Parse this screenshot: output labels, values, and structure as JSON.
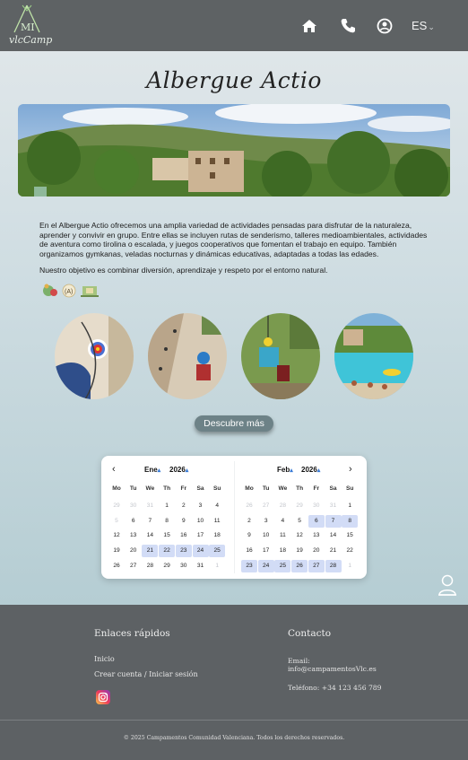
{
  "header": {
    "logo_text": "vlcCamp",
    "logo_letters": "MI",
    "language": "ES",
    "icons": [
      "home-icon",
      "phone-icon",
      "account-icon"
    ]
  },
  "main": {
    "title": "Albergue Actio",
    "paragraph1": "En el Albergue Actio ofrecemos una amplia variedad de actividades pensadas para disfrutar de la naturaleza, aprender y convivir en grupo. Entre ellas se incluyen rutas de senderismo, talleres medioambientales, actividades de aventura como tirolina o escalada, y juegos cooperativos que fomentan el trabajo en equipo. También organizamos gymkanas, veladas nocturnas y dinámicas educativas, adaptadas a todas las edades.",
    "paragraph2": "Nuestro objetivo es combinar diversión, aprendizaje y respeto por el entorno natural.",
    "badge_letter": "(A)",
    "cta": "Descubre más"
  },
  "calendar": {
    "left": {
      "month": "Ene",
      "year": "2026",
      "weekdays": [
        "Mo",
        "Tu",
        "We",
        "Th",
        "Fr",
        "Sa",
        "Su"
      ],
      "weeks": [
        [
          "29",
          "30",
          "31",
          "1",
          "2",
          "3",
          "4"
        ],
        [
          "5",
          "6",
          "7",
          "8",
          "9",
          "10",
          "11"
        ],
        [
          "12",
          "13",
          "14",
          "15",
          "16",
          "17",
          "18"
        ],
        [
          "19",
          "20",
          "21",
          "22",
          "23",
          "24",
          "25"
        ],
        [
          "26",
          "27",
          "28",
          "29",
          "30",
          "31",
          "1"
        ]
      ],
      "muted": [
        [
          0,
          0
        ],
        [
          0,
          1
        ],
        [
          0,
          2
        ],
        [
          1,
          0
        ],
        [
          4,
          6
        ]
      ],
      "highlighted": [
        [
          3,
          2
        ],
        [
          3,
          3
        ],
        [
          3,
          4
        ],
        [
          3,
          5
        ],
        [
          3,
          6
        ]
      ]
    },
    "right": {
      "month": "Feb",
      "year": "2026",
      "weekdays": [
        "Mo",
        "Tu",
        "We",
        "Th",
        "Fr",
        "Sa",
        "Su"
      ],
      "weeks": [
        [
          "26",
          "27",
          "28",
          "29",
          "30",
          "31",
          "1"
        ],
        [
          "2",
          "3",
          "4",
          "5",
          "6",
          "7",
          "8"
        ],
        [
          "9",
          "10",
          "11",
          "12",
          "13",
          "14",
          "15"
        ],
        [
          "16",
          "17",
          "18",
          "19",
          "20",
          "21",
          "22"
        ],
        [
          "23",
          "24",
          "25",
          "26",
          "27",
          "28",
          "1"
        ]
      ],
      "muted": [
        [
          0,
          0
        ],
        [
          0,
          1
        ],
        [
          0,
          2
        ],
        [
          0,
          3
        ],
        [
          0,
          4
        ],
        [
          0,
          5
        ],
        [
          4,
          6
        ]
      ],
      "highlighted": [
        [
          1,
          4
        ],
        [
          1,
          5
        ],
        [
          1,
          6
        ],
        [
          4,
          0
        ],
        [
          4,
          1
        ],
        [
          4,
          2
        ],
        [
          4,
          3
        ],
        [
          4,
          4
        ],
        [
          4,
          5
        ]
      ]
    }
  },
  "footer": {
    "quick_links_title": "Enlaces rápidos",
    "link_home": "Inicio",
    "link_account": "Crear cuenta / Iniciar sesión",
    "contact_title": "Contacto",
    "email_label": "Email:",
    "email": "info@campamentosVlc.es",
    "phone": "Teléfono: +34 123 456 789",
    "copyright": "© 2025 Campamentos Comunidad Valenciana. Todos los derechos reservados."
  }
}
